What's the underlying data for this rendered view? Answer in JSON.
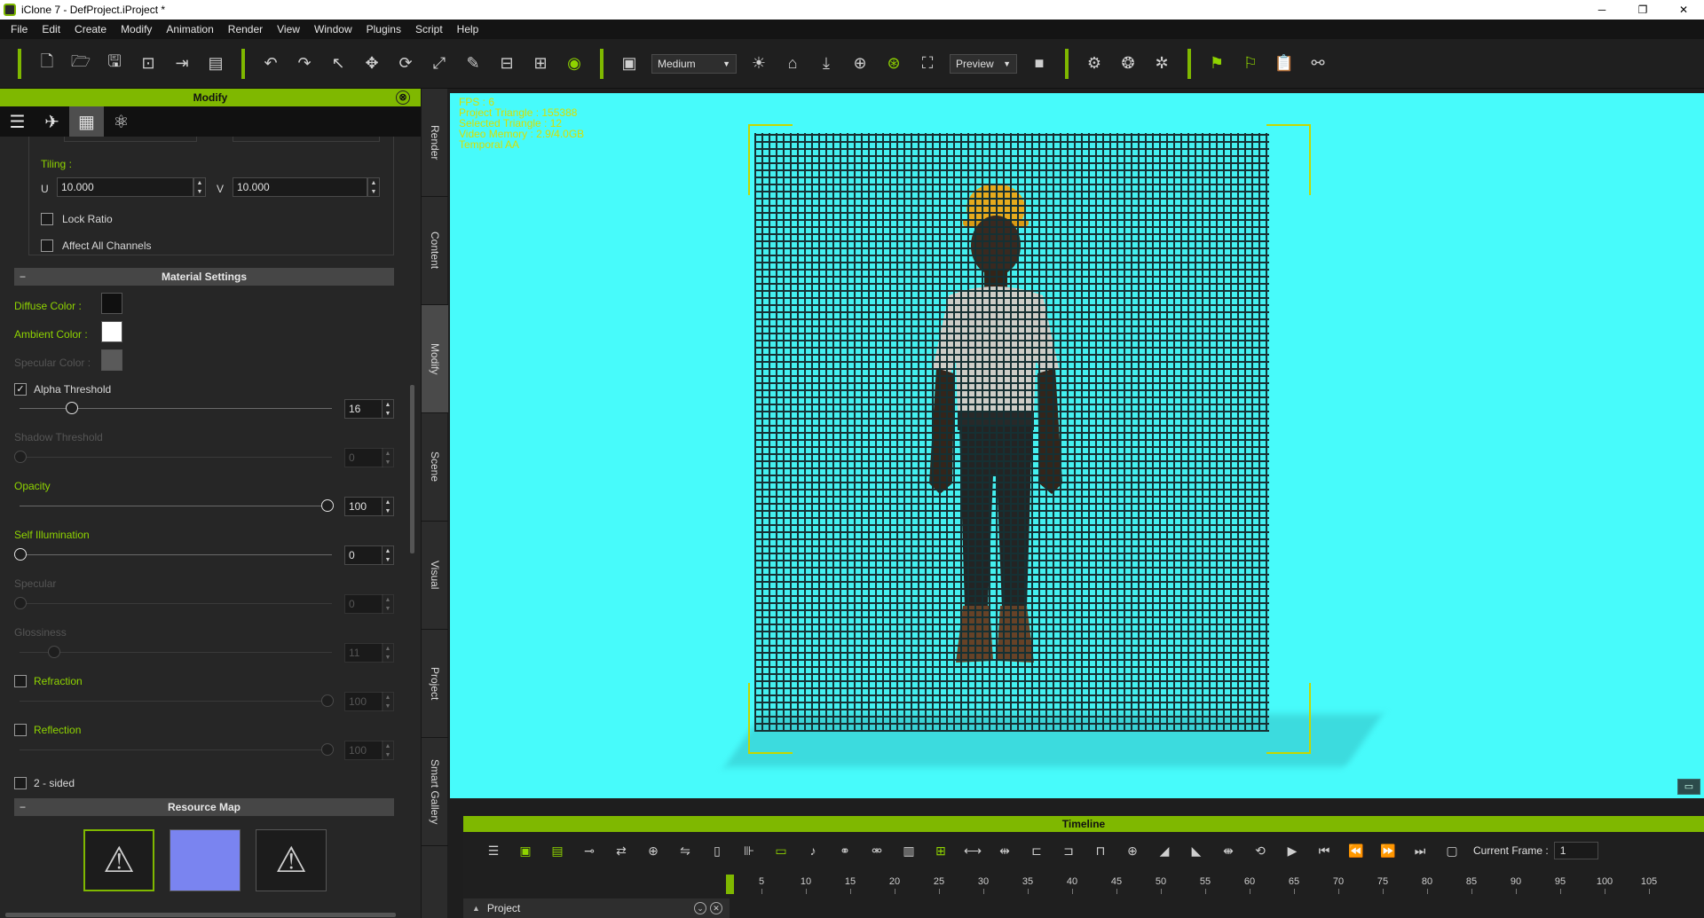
{
  "window": {
    "title": "iClone 7 - DefProject.iProject *",
    "controls": [
      "─",
      "❐",
      "✕"
    ]
  },
  "menu": [
    "File",
    "Edit",
    "Create",
    "Modify",
    "Animation",
    "Render",
    "View",
    "Window",
    "Plugins",
    "Script",
    "Help"
  ],
  "toolbar": {
    "quality": "Medium",
    "render_mode": "Preview"
  },
  "panel": {
    "title": "Modify",
    "close": "⊗",
    "tilling_label": "Tiling :",
    "u_label": "U",
    "u_value": "10.000",
    "v_label": "V",
    "v_value": "10.000",
    "lock_ratio": "Lock Ratio",
    "affect_all": "Affect All Channels",
    "material_settings": "Material Settings",
    "diffuse_label": "Diffuse Color :",
    "ambient_label": "Ambient Color :",
    "specular_color_label": "Specular Color :",
    "alpha_threshold_label": "Alpha Threshold",
    "alpha_threshold_value": "16",
    "shadow_threshold_label": "Shadow Threshold",
    "shadow_threshold_value": "0",
    "opacity_label": "Opacity",
    "opacity_value": "100",
    "self_illum_label": "Self Illumination",
    "self_illum_value": "0",
    "specular_label": "Specular",
    "specular_value": "0",
    "glossiness_label": "Glossiness",
    "glossiness_value": "11",
    "refraction_label": "Refraction",
    "refraction_value": "100",
    "reflection_label": "Reflection",
    "reflection_value": "100",
    "two_sided_label": "2 - sided",
    "resource_map": "Resource Map",
    "colors": {
      "diffuse": "#101010",
      "ambient": "#ffffff",
      "specular": "#5a5a5a"
    }
  },
  "vtabs": [
    "Render",
    "Content",
    "Modify",
    "Scene",
    "Visual",
    "Project",
    "Smart Gallery"
  ],
  "viewport": {
    "hud": [
      "FPS : 6",
      "Project Triangle : 155388",
      "Selected Triangle : 12",
      "Video Memory : 2.9/4.0GB",
      "Temporal AA"
    ]
  },
  "timeline": {
    "title": "Timeline",
    "current_frame_label": "Current Frame :",
    "current_frame": "1",
    "ticks": [
      "5",
      "10",
      "15",
      "20",
      "25",
      "30",
      "35",
      "40",
      "45",
      "50",
      "55",
      "60",
      "65",
      "70",
      "75",
      "80",
      "85",
      "90",
      "95",
      "100",
      "105"
    ],
    "track_name": "Project"
  },
  "colors": {
    "accent": "#7fb800",
    "viewport_bg": "#47fbfb",
    "hud_text": "#d7e000"
  }
}
